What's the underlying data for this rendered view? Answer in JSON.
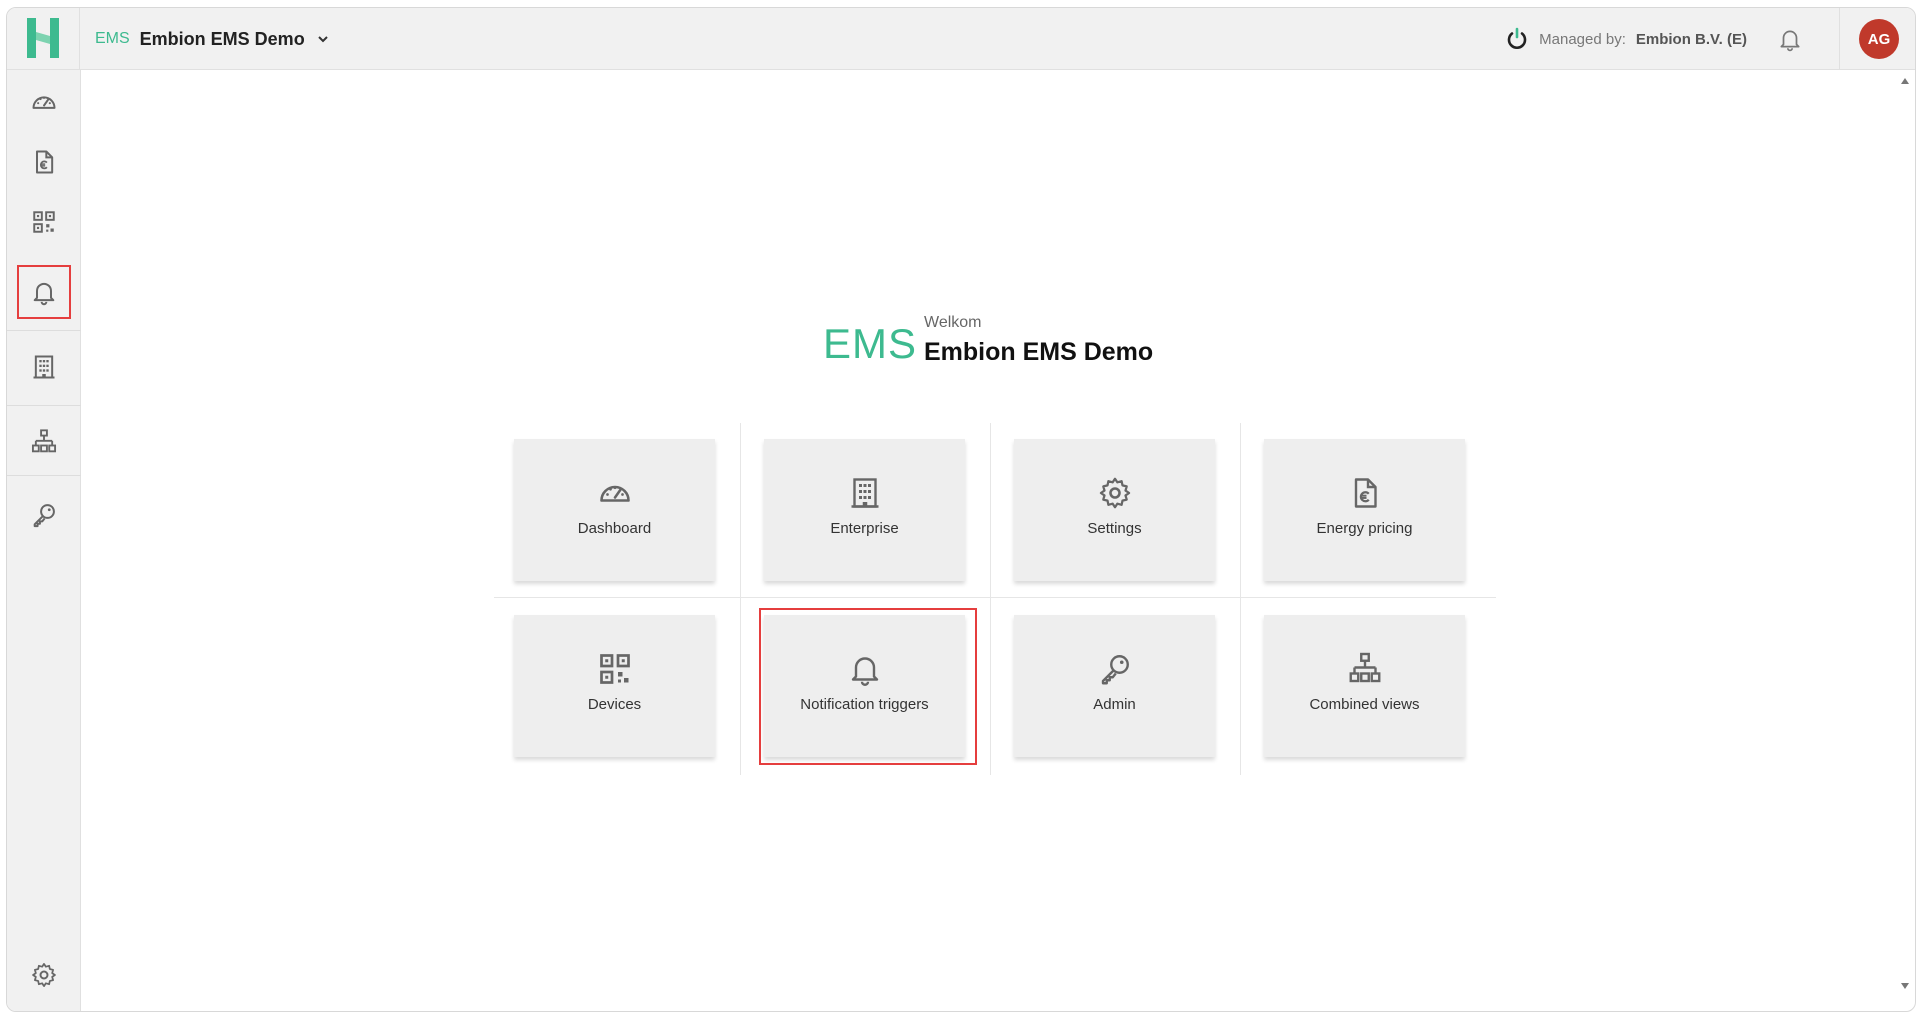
{
  "header": {
    "app_code": "EMS",
    "app_name": "Embion EMS Demo",
    "managed_label": "Managed by:",
    "managed_value": "Embion B.V. (E)",
    "avatar_initials": "AG"
  },
  "sidebar": {
    "items": [
      {
        "icon": "dashboard-icon"
      },
      {
        "icon": "energy-pricing-icon"
      },
      {
        "icon": "devices-icon"
      },
      {
        "icon": "notification-bell-icon",
        "active": true
      },
      {
        "icon": "enterprise-icon"
      },
      {
        "icon": "combined-views-icon"
      },
      {
        "icon": "admin-key-icon"
      },
      {
        "icon": "settings-gear-icon"
      }
    ]
  },
  "welcome": {
    "logo_text": "EMS",
    "label": "Welkom",
    "org_name": "Embion EMS Demo"
  },
  "tiles": [
    {
      "label": "Dashboard",
      "icon": "dashboard-icon"
    },
    {
      "label": "Enterprise",
      "icon": "enterprise-icon"
    },
    {
      "label": "Settings",
      "icon": "settings-gear-icon"
    },
    {
      "label": "Energy pricing",
      "icon": "energy-pricing-icon"
    },
    {
      "label": "Devices",
      "icon": "devices-icon"
    },
    {
      "label": "Notification triggers",
      "icon": "notification-bell-icon"
    },
    {
      "label": "Admin",
      "icon": "admin-key-icon"
    },
    {
      "label": "Combined views",
      "icon": "combined-views-icon"
    }
  ],
  "colors": {
    "brand_green": "#3dba8f",
    "avatar_red": "#c0392b",
    "highlight_red": "#e53e3e",
    "icon_gray": "#666666"
  }
}
